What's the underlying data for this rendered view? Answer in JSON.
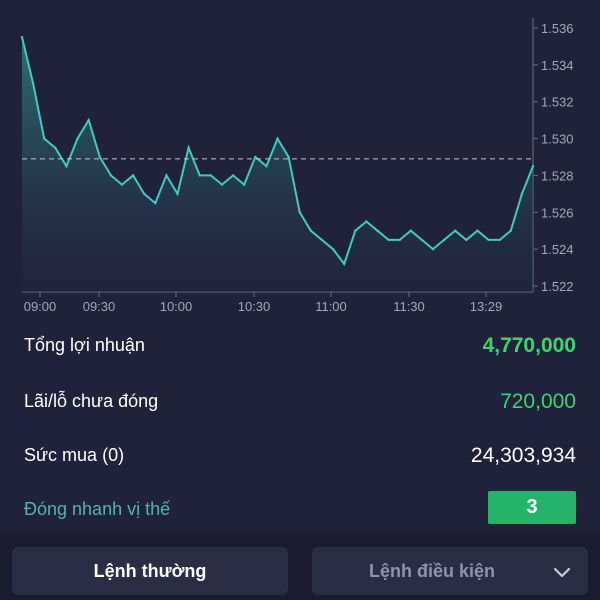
{
  "chart": {
    "y_ticks": [
      "1.536",
      "1.534",
      "1.532",
      "1.530",
      "1.528",
      "1.526",
      "1.524",
      "1.522"
    ],
    "x_ticks": [
      "09:00",
      "09:30",
      "10:00",
      "10:30",
      "11:00",
      "11:30",
      "13:29"
    ],
    "reference_value": 1.5289,
    "line_color": "#3ecdc0"
  },
  "chart_data": {
    "type": "area",
    "title": "",
    "xlabel": "",
    "ylabel": "",
    "ylim": [
      1.522,
      1.536
    ],
    "x": [
      "09:00",
      "09:04",
      "09:09",
      "09:14",
      "09:18",
      "09:22",
      "09:26",
      "09:30",
      "09:34",
      "09:38",
      "09:43",
      "09:47",
      "09:51",
      "09:55",
      "10:00",
      "10:04",
      "10:08",
      "10:13",
      "10:17",
      "10:21",
      "10:25",
      "10:30",
      "10:34",
      "10:38",
      "10:43",
      "10:47",
      "10:51",
      "10:55",
      "11:00",
      "11:04",
      "11:08",
      "11:13",
      "11:17",
      "11:21",
      "11:25",
      "11:30",
      "11:34",
      "11:38",
      "11:42",
      "11:46",
      "11:50",
      "13:05",
      "13:10",
      "13:15",
      "13:20",
      "13:25",
      "13:29"
    ],
    "series": [
      {
        "values": [
          1.5355,
          1.533,
          1.53,
          1.5295,
          1.5285,
          1.53,
          1.531,
          1.529,
          1.528,
          1.5275,
          1.528,
          1.527,
          1.5265,
          1.528,
          1.527,
          1.5295,
          1.528,
          1.528,
          1.5275,
          1.528,
          1.5275,
          1.529,
          1.5285,
          1.53,
          1.529,
          1.526,
          1.525,
          1.5245,
          1.524,
          1.5232,
          1.525,
          1.5255,
          1.525,
          1.5245,
          1.5245,
          1.525,
          1.5245,
          1.524,
          1.5245,
          1.525,
          1.5245,
          1.525,
          1.5245,
          1.5245,
          1.525,
          1.527,
          1.5285
        ]
      }
    ],
    "reference_line": 1.5289,
    "grid": false
  },
  "stats": {
    "total_profit_label": "Tổng lợi nhuận",
    "total_profit_value": "4,770,000",
    "unrealized_label": "Lãi/lỗ chưa đóng",
    "unrealized_value": "720,000",
    "buying_power_label": "Sức mua (0)",
    "buying_power_value": "24,303,934",
    "quick_close_label": "Đóng nhanh vị thế",
    "quick_close_count": "3"
  },
  "bottom": {
    "normal_order": "Lệnh thường",
    "conditional_order": "Lệnh điều kiện"
  },
  "colors": {
    "background": "#20213a",
    "positive": "#37d86c",
    "accent_teal": "#4fb5b0",
    "badge": "#23b46a"
  }
}
